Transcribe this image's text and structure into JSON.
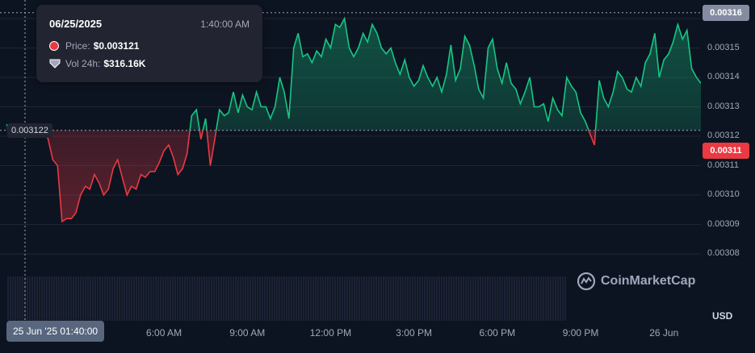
{
  "tooltip": {
    "date": "06/25/2025",
    "time": "1:40:00 AM",
    "price_label": "Price:",
    "price_value": "$0.003121",
    "vol_label": "Vol 24h:",
    "vol_value": "$316.16K"
  },
  "cursor": {
    "x_label": "25 Jun '25 01:40:00",
    "y_label": "0.003122",
    "y_value": 0.003122
  },
  "brand": "CoinMarketCap",
  "currency": "USD",
  "colors": {
    "up": "#16c784",
    "down": "#ea3943",
    "background": "#0d1421",
    "grid": "#222531"
  },
  "chart_data": {
    "type": "area",
    "baseline": 0.003122,
    "ylim": [
      0.003077,
      0.003162
    ],
    "y_ticks": [
      "0.00316",
      "0.00315",
      "0.00314",
      "0.00313",
      "0.00312",
      "0.00311",
      "0.00310",
      "0.00309",
      "0.00308"
    ],
    "y_tick_values": [
      0.00316,
      0.00315,
      0.00314,
      0.00313,
      0.00312,
      0.00311,
      0.0031,
      0.00309,
      0.00308
    ],
    "x_ticks": [
      "6:00 AM",
      "9:00 AM",
      "12:00 PM",
      "3:00 PM",
      "6:00 PM",
      "9:00 PM",
      "26 Jun"
    ],
    "x_tick_hours": [
      6,
      9,
      12,
      15,
      18,
      21,
      24
    ],
    "current_price_label": "0.00311",
    "current_price": 0.003115,
    "high_label": "0.00316",
    "high": 0.003162,
    "series": [
      {
        "x_hours": [
          0.33,
          0.5,
          0.67,
          0.83,
          1.0,
          1.17,
          1.33,
          1.5,
          1.67,
          1.83,
          2.0,
          2.17,
          2.33,
          2.5,
          2.67,
          2.83,
          3.0,
          3.17,
          3.33,
          3.5,
          3.67,
          3.83,
          4.0,
          4.17,
          4.33,
          4.5,
          4.67,
          4.83,
          5.0,
          5.17,
          5.33,
          5.5,
          5.67,
          5.83,
          6.0,
          6.17,
          6.33,
          6.5,
          6.67,
          6.83,
          7.0,
          7.17,
          7.33,
          7.5,
          7.67,
          7.83,
          8.0,
          8.17,
          8.33,
          8.5,
          8.67,
          8.83,
          9.0,
          9.17,
          9.33,
          9.5,
          9.67,
          9.83,
          10.0,
          10.17,
          10.33,
          10.5,
          10.67,
          10.83,
          11.0,
          11.17,
          11.33,
          11.5,
          11.67,
          11.83,
          12.0,
          12.17,
          12.33,
          12.5,
          12.67,
          12.83,
          13.0,
          13.17,
          13.33,
          13.5,
          13.67,
          13.83,
          14.0,
          14.17,
          14.33,
          14.5,
          14.67,
          14.83,
          15.0,
          15.17,
          15.33,
          15.5,
          15.67,
          15.83,
          16.0,
          16.17,
          16.33,
          16.5,
          16.67,
          16.83,
          17.0,
          17.17,
          17.33,
          17.5,
          17.67,
          17.83,
          18.0,
          18.17,
          18.33,
          18.5,
          18.67,
          18.83,
          19.0,
          19.17,
          19.33,
          19.5,
          19.67,
          19.83,
          20.0,
          20.17,
          20.33,
          20.5,
          20.67,
          20.83,
          21.0,
          21.17,
          21.33,
          21.5,
          21.67,
          21.83,
          22.0,
          22.17,
          22.33,
          22.5,
          22.67,
          22.83,
          23.0,
          23.17,
          23.33,
          23.5,
          23.67,
          23.83,
          24.0,
          24.17,
          24.33,
          24.5,
          24.67,
          24.83,
          25.0,
          25.17,
          25.33
        ],
        "values": [
          0.003124,
          0.003122,
          0.003124,
          0.003123,
          0.003121,
          0.003124,
          0.003123,
          0.003122,
          0.003122,
          0.003119,
          0.003112,
          0.00311,
          0.003091,
          0.003092,
          0.003092,
          0.003094,
          0.0031,
          0.003103,
          0.003102,
          0.003107,
          0.003104,
          0.0031,
          0.003102,
          0.003109,
          0.003112,
          0.003106,
          0.0031,
          0.003103,
          0.003102,
          0.003107,
          0.003106,
          0.003108,
          0.003108,
          0.003111,
          0.003115,
          0.003117,
          0.003113,
          0.003107,
          0.003109,
          0.003114,
          0.003127,
          0.003129,
          0.003119,
          0.003126,
          0.00311,
          0.003119,
          0.003129,
          0.003127,
          0.003128,
          0.003135,
          0.003128,
          0.003134,
          0.00313,
          0.003129,
          0.003135,
          0.00313,
          0.00313,
          0.003126,
          0.00313,
          0.00314,
          0.003135,
          0.003126,
          0.00315,
          0.003155,
          0.003147,
          0.003148,
          0.003145,
          0.003149,
          0.003147,
          0.003153,
          0.00315,
          0.003158,
          0.003157,
          0.00316,
          0.00315,
          0.003147,
          0.00315,
          0.003155,
          0.003152,
          0.003158,
          0.003155,
          0.00315,
          0.003148,
          0.00315,
          0.003145,
          0.003141,
          0.003146,
          0.00314,
          0.003137,
          0.003139,
          0.003144,
          0.00314,
          0.003137,
          0.00314,
          0.003135,
          0.003141,
          0.003151,
          0.003139,
          0.003143,
          0.003154,
          0.003151,
          0.003144,
          0.003136,
          0.003133,
          0.00315,
          0.003153,
          0.003143,
          0.003138,
          0.003145,
          0.003138,
          0.003136,
          0.003131,
          0.003135,
          0.00314,
          0.00313,
          0.00313,
          0.003131,
          0.003125,
          0.003133,
          0.003129,
          0.003127,
          0.00314,
          0.003137,
          0.003135,
          0.003128,
          0.003125,
          0.003121,
          0.003117,
          0.003139,
          0.003133,
          0.00313,
          0.003135,
          0.003142,
          0.00314,
          0.003136,
          0.003135,
          0.00314,
          0.003137,
          0.003145,
          0.003148,
          0.003155,
          0.00314,
          0.003146,
          0.003148,
          0.003152,
          0.003158,
          0.003153,
          0.003156,
          0.003143,
          0.00314,
          0.003138,
          0.003134,
          0.00314,
          0.003132,
          0.003136,
          0.003146,
          0.003141,
          0.00314,
          0.003137,
          0.003136,
          0.003138,
          0.003134,
          0.003136,
          0.003142,
          0.003137,
          0.003142,
          0.003146,
          0.003138,
          0.003147,
          0.00314,
          0.00313,
          0.003137,
          0.003131,
          0.003134,
          0.003128,
          0.00313,
          0.003134,
          0.003126,
          0.003136,
          0.00314,
          0.003134,
          0.003138,
          0.003136,
          0.003138,
          0.003138,
          0.003137,
          0.003133,
          0.003126,
          0.003126,
          0.003124,
          0.00312,
          0.00312,
          0.003118,
          0.00312,
          0.003124,
          0.003122,
          0.003125,
          0.003123,
          0.003122,
          0.003122,
          0.003124,
          0.003122
        ]
      }
    ]
  }
}
